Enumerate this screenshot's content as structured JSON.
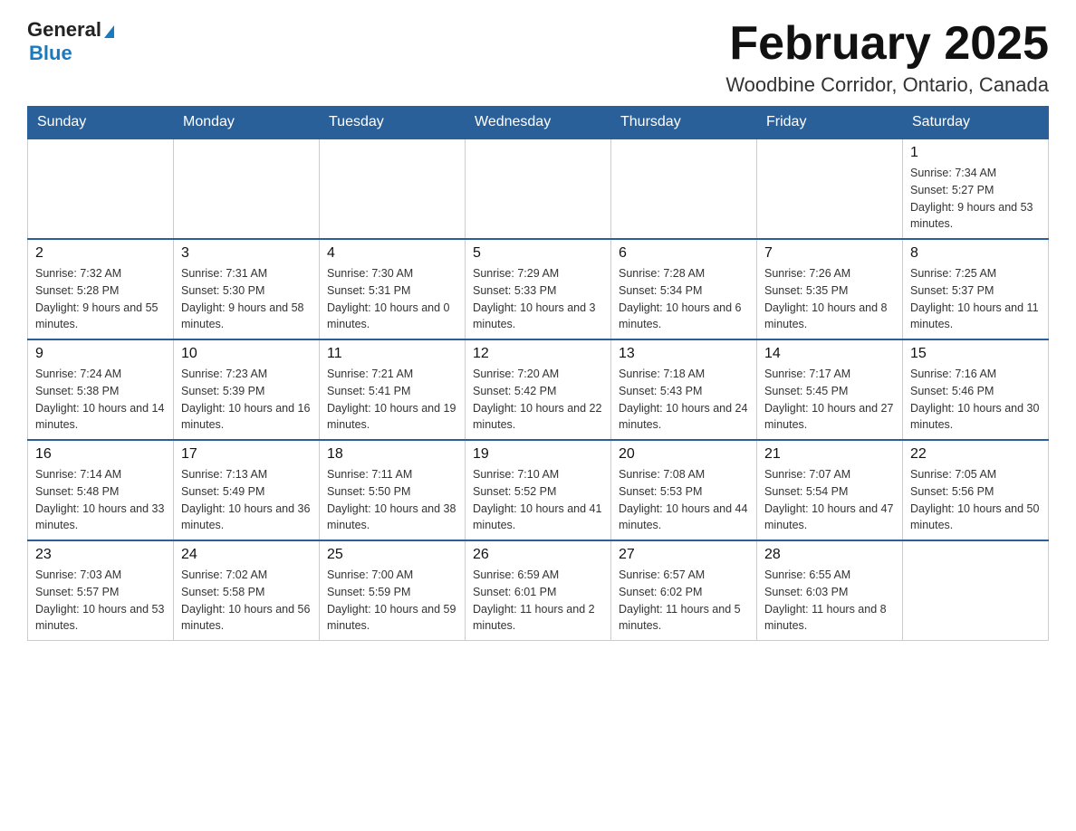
{
  "header": {
    "logo_general": "General",
    "logo_blue": "Blue",
    "month_title": "February 2025",
    "location": "Woodbine Corridor, Ontario, Canada"
  },
  "weekdays": [
    "Sunday",
    "Monday",
    "Tuesday",
    "Wednesday",
    "Thursday",
    "Friday",
    "Saturday"
  ],
  "weeks": [
    [
      {
        "day": "",
        "info": ""
      },
      {
        "day": "",
        "info": ""
      },
      {
        "day": "",
        "info": ""
      },
      {
        "day": "",
        "info": ""
      },
      {
        "day": "",
        "info": ""
      },
      {
        "day": "",
        "info": ""
      },
      {
        "day": "1",
        "info": "Sunrise: 7:34 AM\nSunset: 5:27 PM\nDaylight: 9 hours and 53 minutes."
      }
    ],
    [
      {
        "day": "2",
        "info": "Sunrise: 7:32 AM\nSunset: 5:28 PM\nDaylight: 9 hours and 55 minutes."
      },
      {
        "day": "3",
        "info": "Sunrise: 7:31 AM\nSunset: 5:30 PM\nDaylight: 9 hours and 58 minutes."
      },
      {
        "day": "4",
        "info": "Sunrise: 7:30 AM\nSunset: 5:31 PM\nDaylight: 10 hours and 0 minutes."
      },
      {
        "day": "5",
        "info": "Sunrise: 7:29 AM\nSunset: 5:33 PM\nDaylight: 10 hours and 3 minutes."
      },
      {
        "day": "6",
        "info": "Sunrise: 7:28 AM\nSunset: 5:34 PM\nDaylight: 10 hours and 6 minutes."
      },
      {
        "day": "7",
        "info": "Sunrise: 7:26 AM\nSunset: 5:35 PM\nDaylight: 10 hours and 8 minutes."
      },
      {
        "day": "8",
        "info": "Sunrise: 7:25 AM\nSunset: 5:37 PM\nDaylight: 10 hours and 11 minutes."
      }
    ],
    [
      {
        "day": "9",
        "info": "Sunrise: 7:24 AM\nSunset: 5:38 PM\nDaylight: 10 hours and 14 minutes."
      },
      {
        "day": "10",
        "info": "Sunrise: 7:23 AM\nSunset: 5:39 PM\nDaylight: 10 hours and 16 minutes."
      },
      {
        "day": "11",
        "info": "Sunrise: 7:21 AM\nSunset: 5:41 PM\nDaylight: 10 hours and 19 minutes."
      },
      {
        "day": "12",
        "info": "Sunrise: 7:20 AM\nSunset: 5:42 PM\nDaylight: 10 hours and 22 minutes."
      },
      {
        "day": "13",
        "info": "Sunrise: 7:18 AM\nSunset: 5:43 PM\nDaylight: 10 hours and 24 minutes."
      },
      {
        "day": "14",
        "info": "Sunrise: 7:17 AM\nSunset: 5:45 PM\nDaylight: 10 hours and 27 minutes."
      },
      {
        "day": "15",
        "info": "Sunrise: 7:16 AM\nSunset: 5:46 PM\nDaylight: 10 hours and 30 minutes."
      }
    ],
    [
      {
        "day": "16",
        "info": "Sunrise: 7:14 AM\nSunset: 5:48 PM\nDaylight: 10 hours and 33 minutes."
      },
      {
        "day": "17",
        "info": "Sunrise: 7:13 AM\nSunset: 5:49 PM\nDaylight: 10 hours and 36 minutes."
      },
      {
        "day": "18",
        "info": "Sunrise: 7:11 AM\nSunset: 5:50 PM\nDaylight: 10 hours and 38 minutes."
      },
      {
        "day": "19",
        "info": "Sunrise: 7:10 AM\nSunset: 5:52 PM\nDaylight: 10 hours and 41 minutes."
      },
      {
        "day": "20",
        "info": "Sunrise: 7:08 AM\nSunset: 5:53 PM\nDaylight: 10 hours and 44 minutes."
      },
      {
        "day": "21",
        "info": "Sunrise: 7:07 AM\nSunset: 5:54 PM\nDaylight: 10 hours and 47 minutes."
      },
      {
        "day": "22",
        "info": "Sunrise: 7:05 AM\nSunset: 5:56 PM\nDaylight: 10 hours and 50 minutes."
      }
    ],
    [
      {
        "day": "23",
        "info": "Sunrise: 7:03 AM\nSunset: 5:57 PM\nDaylight: 10 hours and 53 minutes."
      },
      {
        "day": "24",
        "info": "Sunrise: 7:02 AM\nSunset: 5:58 PM\nDaylight: 10 hours and 56 minutes."
      },
      {
        "day": "25",
        "info": "Sunrise: 7:00 AM\nSunset: 5:59 PM\nDaylight: 10 hours and 59 minutes."
      },
      {
        "day": "26",
        "info": "Sunrise: 6:59 AM\nSunset: 6:01 PM\nDaylight: 11 hours and 2 minutes."
      },
      {
        "day": "27",
        "info": "Sunrise: 6:57 AM\nSunset: 6:02 PM\nDaylight: 11 hours and 5 minutes."
      },
      {
        "day": "28",
        "info": "Sunrise: 6:55 AM\nSunset: 6:03 PM\nDaylight: 11 hours and 8 minutes."
      },
      {
        "day": "",
        "info": ""
      }
    ]
  ]
}
